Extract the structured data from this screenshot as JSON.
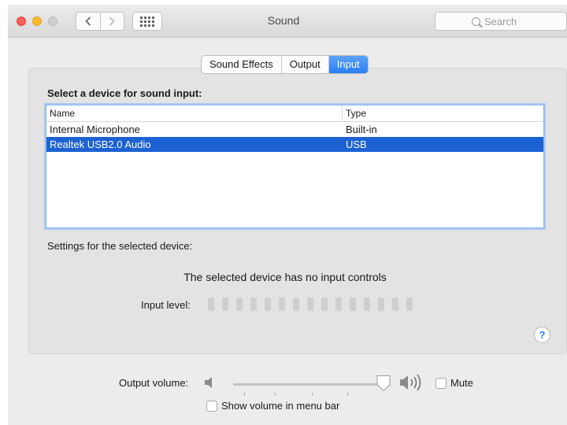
{
  "window": {
    "title": "Sound",
    "search_placeholder": "Search"
  },
  "icons": {
    "back": "chevron-left-icon",
    "forward": "chevron-right-icon",
    "show_all": "grid-icon",
    "search": "search-icon",
    "volume_low": "speaker-low-icon",
    "volume_high": "speaker-high-icon",
    "help": "help-icon"
  },
  "tabs": [
    {
      "label": "Sound Effects",
      "active": false
    },
    {
      "label": "Output",
      "active": false
    },
    {
      "label": "Input",
      "active": true
    }
  ],
  "input": {
    "heading": "Select a device for sound input:",
    "columns": [
      "Name",
      "Type"
    ],
    "devices": [
      {
        "name": "Internal Microphone",
        "type": "Built-in",
        "selected": false
      },
      {
        "name": "Realtek USB2.0 Audio",
        "type": "USB",
        "selected": true
      }
    ],
    "settings_label": "Settings for the selected device:",
    "no_controls": "The selected device has no input controls",
    "input_level_label": "Input level:",
    "input_level_segments": 15,
    "input_level_value": 0,
    "help_label": "?"
  },
  "output": {
    "volume_label": "Output volume:",
    "volume_value": 1.0,
    "mute_label": "Mute",
    "mute_checked": false,
    "show_volume_label": "Show volume in menu bar",
    "show_volume_checked": false
  },
  "colors": {
    "accent": "#2a7ef5",
    "selection": "#1c62d3",
    "close": "#fc5f57",
    "minimize": "#fdbc2e"
  }
}
